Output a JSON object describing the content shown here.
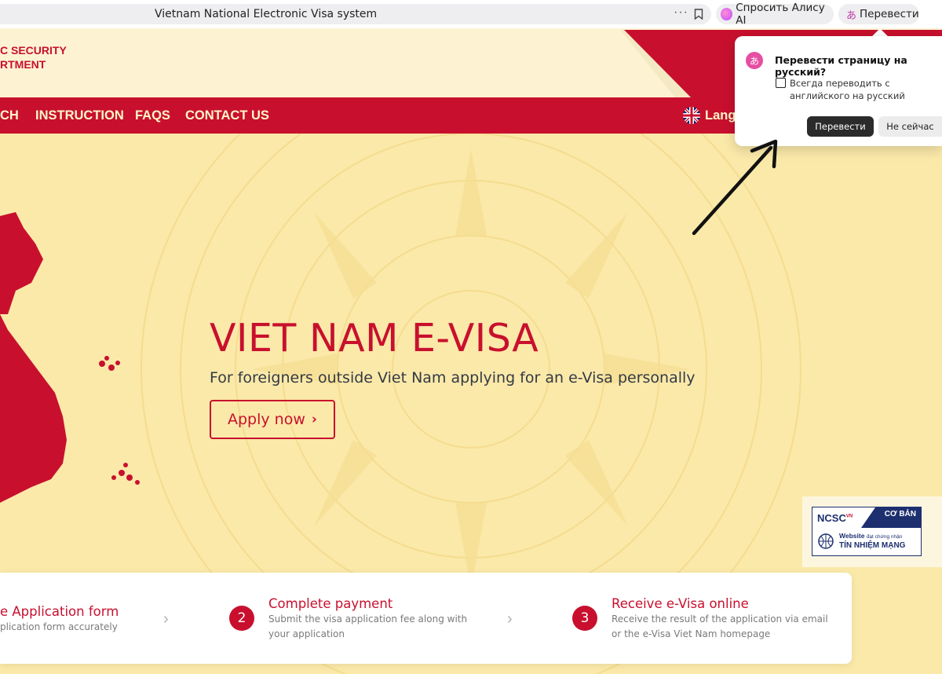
{
  "browser": {
    "tab_title": "Vietnam National Electronic Visa system",
    "more_icon": "ellipsis-icon",
    "bookmark_icon": "bookmark-icon",
    "alice_button": "Спросить Алису AI",
    "translate_button": "Перевести"
  },
  "header": {
    "dept_line1": "C SECURITY",
    "dept_line2": "RTMENT"
  },
  "nav": {
    "items": [
      "CH",
      "INSTRUCTION",
      "FAQS",
      "CONTACT US"
    ],
    "language": "Lang"
  },
  "hero": {
    "title": "VIET NAM E-VISA",
    "subtitle": "For foreigners outside Viet Nam applying for an e-Visa personally",
    "apply_label": "Apply now"
  },
  "steps": [
    {
      "number": "",
      "title": "e Application form",
      "desc_line1": "plication form accurately",
      "desc_line2": ""
    },
    {
      "number": "2",
      "title": "Complete payment",
      "desc_line1": "Submit the visa application fee along with",
      "desc_line2": "your application"
    },
    {
      "number": "3",
      "title": "Receive e-Visa online",
      "desc_line1": "Receive the result of the application via email",
      "desc_line2": "or the e-Visa Viet Nam homepage"
    }
  ],
  "badge": {
    "brand": "NCSC",
    "brand_sub": "VN",
    "level": "CƠ BẢN",
    "line1_a": "Website",
    "line1_b": "đạt chứng nhận",
    "line2": "TÍN NHIỆM MẠNG"
  },
  "translate_popup": {
    "icon_glyph": "あ",
    "title": "Перевести страницу на русский?",
    "always_label": "Всегда переводить с английского на русский",
    "always_checked": false,
    "translate_label": "Перевести",
    "not_now_label": "Не сейчас"
  },
  "colors": {
    "brand_red": "#c8102e",
    "background": "#fbe9a9",
    "nav_text": "#fff6c8"
  }
}
